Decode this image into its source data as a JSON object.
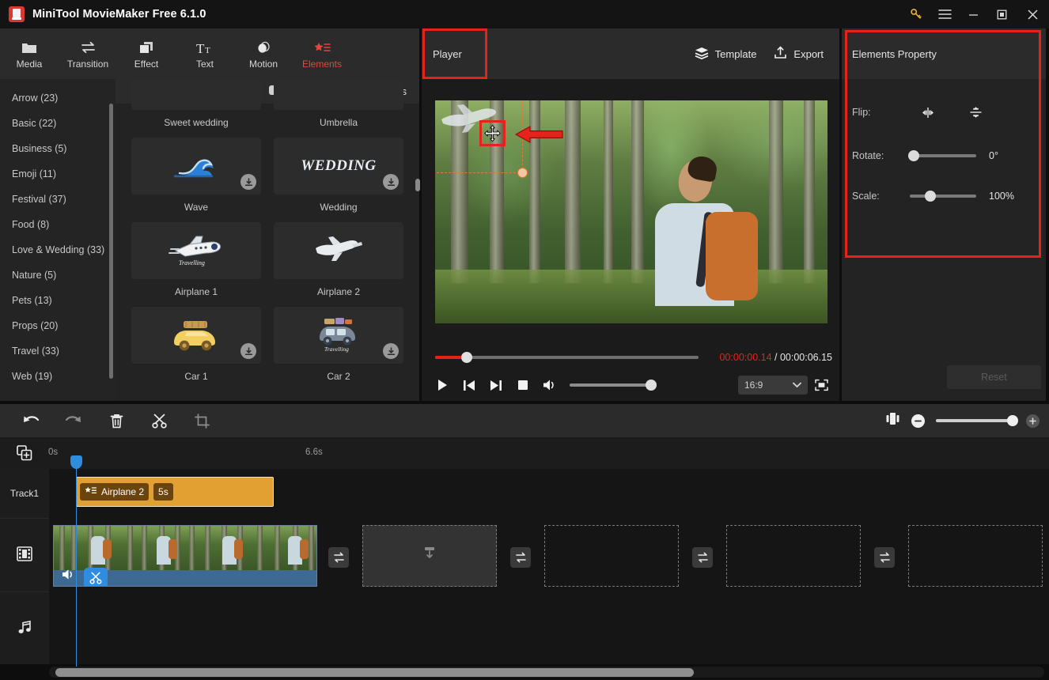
{
  "titlebar": {
    "app_title": "MiniTool MovieMaker Free 6.1.0",
    "logo_icon": "minitool-logo-icon",
    "buttons": [
      {
        "name": "key-icon",
        "label": "⚷"
      },
      {
        "name": "menu-icon",
        "label": "☰"
      },
      {
        "name": "minimize-icon",
        "label": "—"
      },
      {
        "name": "maximize-icon",
        "label": "□"
      },
      {
        "name": "close-icon",
        "label": "✕"
      }
    ]
  },
  "toolbar": {
    "tabs": [
      {
        "label": "Media",
        "icon": "folder-icon",
        "active": false
      },
      {
        "label": "Transition",
        "icon": "transition-arrows-icon",
        "active": false
      },
      {
        "label": "Effect",
        "icon": "layers-icon",
        "active": false
      },
      {
        "label": "Text",
        "icon": "text-icon",
        "active": false
      },
      {
        "label": "Motion",
        "icon": "motion-icon",
        "active": false
      },
      {
        "label": "Elements",
        "icon": "elements-star-icon",
        "active": true
      }
    ]
  },
  "library": {
    "categories": [
      {
        "label": "Arrow (23)"
      },
      {
        "label": "Basic (22)"
      },
      {
        "label": "Business (5)"
      },
      {
        "label": "Emoji (11)"
      },
      {
        "label": "Festival (37)"
      },
      {
        "label": "Food (8)"
      },
      {
        "label": "Love & Wedding (33)"
      },
      {
        "label": "Nature (5)"
      },
      {
        "label": "Pets (13)"
      },
      {
        "label": "Props (20)"
      },
      {
        "label": "Travel (33)"
      },
      {
        "label": "Web (19)"
      }
    ],
    "download_youtube_label": "Download YouTube Videos",
    "download_youtube_icon": "youtube-icon",
    "items": [
      {
        "label": "Sweet wedding",
        "icon": "sweet-wedding-thumb",
        "download": false,
        "partial": true
      },
      {
        "label": "Umbrella",
        "icon": "umbrella-thumb",
        "download": false,
        "partial": true
      },
      {
        "label": "Wave",
        "icon": "wave-thumb",
        "download": true,
        "partial": false
      },
      {
        "label": "Wedding",
        "icon": "wedding-text-thumb",
        "download": true,
        "partial": false
      },
      {
        "label": "Airplane 1",
        "icon": "airplane-1-thumb",
        "download": false,
        "partial": false
      },
      {
        "label": "Airplane 2",
        "icon": "airplane-2-thumb",
        "download": false,
        "partial": false
      },
      {
        "label": "Car 1",
        "icon": "car-1-thumb",
        "download": true,
        "partial": false
      },
      {
        "label": "Car 2",
        "icon": "car-2-thumb",
        "download": true,
        "partial": false
      }
    ]
  },
  "player": {
    "panel_label": "Player",
    "template_label": "Template",
    "template_icon": "layers-icon",
    "export_label": "Export",
    "export_icon": "export-upload-icon",
    "current_time": "00:00:00.14",
    "time_separator": " / ",
    "total_time": "00:00:06.15",
    "aspect_ratio": "16:9",
    "aspect_chevron_icon": "chevron-down-icon",
    "fullscreen_icon": "fullscreen-icon",
    "controls": [
      {
        "name": "play-button",
        "icon": "play-icon"
      },
      {
        "name": "prev-frame-button",
        "icon": "skip-back-icon"
      },
      {
        "name": "next-frame-button",
        "icon": "skip-forward-icon"
      },
      {
        "name": "stop-button",
        "icon": "stop-icon"
      },
      {
        "name": "volume-button",
        "icon": "volume-icon"
      }
    ],
    "overlay": {
      "move_cursor_icon": "move-cursor-icon",
      "annotation_arrow_icon": "red-arrow-left-icon",
      "element_icon": "airplane-overlay"
    }
  },
  "properties": {
    "title": "Elements Property",
    "flip_label": "Flip:",
    "flip_horizontal_icon": "flip-horizontal-icon",
    "flip_vertical_icon": "flip-vertical-icon",
    "rotate_label": "Rotate:",
    "rotate_value": "0°",
    "scale_label": "Scale:",
    "scale_value": "100%",
    "reset_label": "Reset"
  },
  "timeline_toolbar": {
    "buttons": [
      {
        "name": "undo-button",
        "icon": "undo-icon"
      },
      {
        "name": "redo-button",
        "icon": "redo-icon"
      },
      {
        "name": "delete-button",
        "icon": "trash-icon"
      },
      {
        "name": "split-button",
        "icon": "scissors-icon"
      },
      {
        "name": "crop-button",
        "icon": "crop-icon"
      }
    ],
    "split_view_icon": "split-view-icon",
    "zoom_out_icon": "zoom-out-icon",
    "zoom_in_icon": "zoom-in-icon"
  },
  "timeline": {
    "add_track_icon": "add-media-icon",
    "ruler_ticks": [
      "0s",
      "6.6s"
    ],
    "track1_label": "Track1",
    "video_track_icon": "film-icon",
    "audio_track_icon": "music-note-icon",
    "element_clip": {
      "name": "Airplane 2",
      "duration": "5s",
      "icon": "elements-star-icon"
    },
    "video_clip": {
      "mute_icon": "volume-icon",
      "split_badge_icon": "scissors-icon"
    },
    "transition_icon": "transition-arrows-icon",
    "placeholder_icon": "import-media-icon"
  },
  "colors": {
    "accent_red": "#e5231b",
    "clip_orange": "#e2a032",
    "playhead_blue": "#2f8de0",
    "panel_bg": "#232323",
    "toolbar_bg": "#2b2b2b"
  }
}
